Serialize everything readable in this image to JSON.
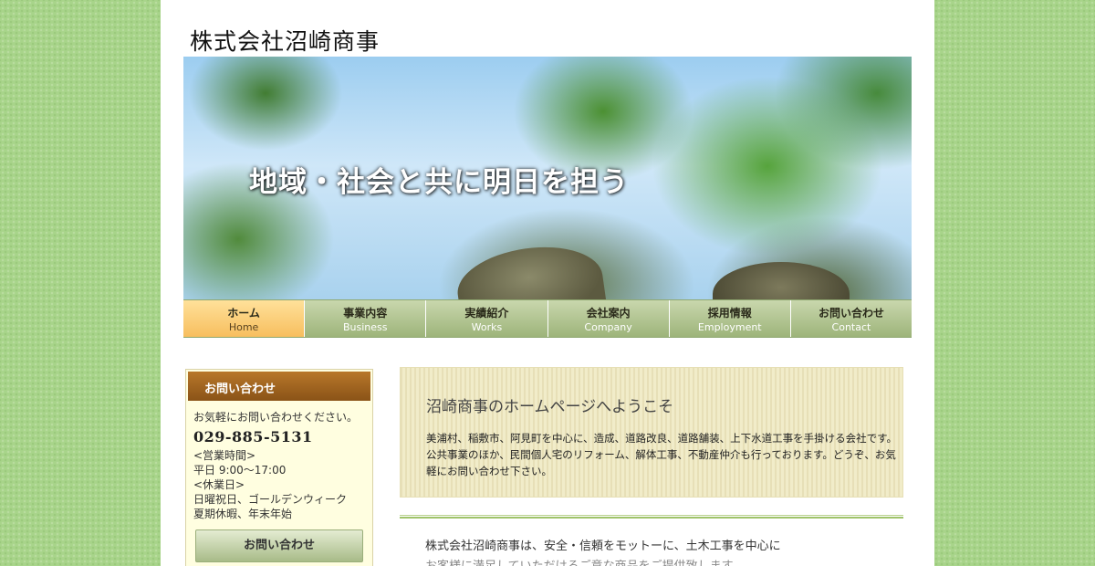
{
  "site": {
    "logo": "株式会社沼崎商事"
  },
  "hero": {
    "title": "地域・社会と共に明日を担う"
  },
  "nav": [
    {
      "jp": "ホーム",
      "en": "Home",
      "active": true
    },
    {
      "jp": "事業内容",
      "en": "Business"
    },
    {
      "jp": "実績紹介",
      "en": "Works"
    },
    {
      "jp": "会社案内",
      "en": "Company"
    },
    {
      "jp": "採用情報",
      "en": "Employment"
    },
    {
      "jp": "お問い合わせ",
      "en": "Contact"
    }
  ],
  "sidebar": {
    "heading": "お問い合わせ",
    "intro": "お気軽にお問い合わせください。",
    "phone": "029-885-5131",
    "hours_label": "<営業時間>",
    "hours": "平日 9:00〜17:00",
    "closed_label": "<休業日>",
    "closed_1": "日曜祝日、ゴールデンウィーク",
    "closed_2": "夏期休暇、年末年始",
    "button": "お問い合わせ"
  },
  "welcome": {
    "title": "沼崎商事のホームページへようこそ",
    "body": "美浦村、稲敷市、阿見町を中心に、造成、道路改良、道路舗装、上下水道工事を手掛ける会社です。公共事業のほか、民間個人宅のリフォーム、解体工事、不動産仲介も行っております。どうぞ、お気軽にお問い合わせ下さい。"
  },
  "main": {
    "line1": "株式会社沼崎商事は、安全・信頼をモットーに、土木工事を中心に",
    "line2": "お客様に満足していただけるご意な商品をご提供致します"
  }
}
